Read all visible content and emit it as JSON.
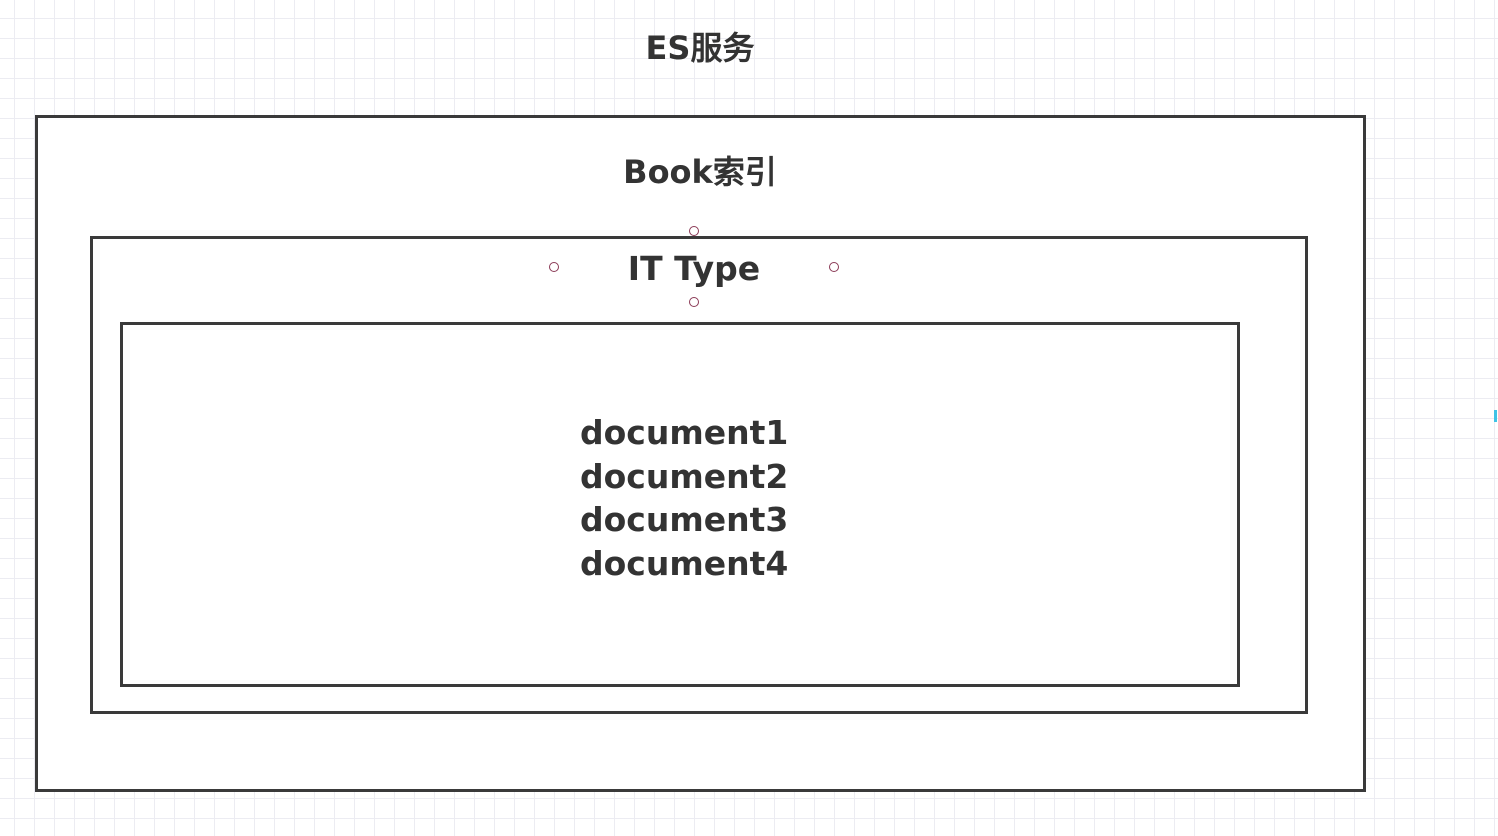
{
  "diagram": {
    "service_title": "ES服务",
    "index_title": "Book索引",
    "type_title": "IT Type",
    "documents": [
      "document1",
      "document2",
      "document3",
      "document4"
    ]
  },
  "colors": {
    "border": "#3a3a3a",
    "text": "#333333",
    "handle": "#8b3a56",
    "grid": "#ececf2",
    "edge_mark": "#3fc3e6"
  }
}
